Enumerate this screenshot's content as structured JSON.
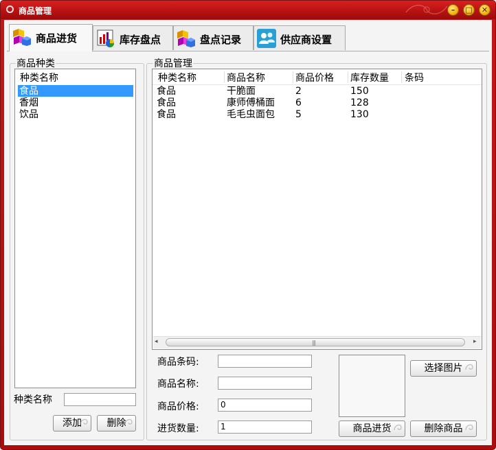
{
  "window": {
    "title": "商品管理"
  },
  "tabs": [
    {
      "label": "商品进货",
      "icon": "cubes-icon",
      "active": true
    },
    {
      "label": "库存盘点",
      "icon": "chart-icon",
      "active": false
    },
    {
      "label": "盘点记录",
      "icon": "cubes-icon",
      "active": false
    },
    {
      "label": "供应商设置",
      "icon": "users-icon",
      "active": false
    }
  ],
  "category_panel": {
    "title": "商品种类",
    "column": "种类名称",
    "items": [
      "食品",
      "香烟",
      "饮品"
    ],
    "selected_index": 0,
    "name_label": "种类名称",
    "name_value": "",
    "add_label": "添加",
    "delete_label": "删除"
  },
  "product_panel": {
    "title": "商品管理",
    "columns": [
      "种类名称",
      "商品名称",
      "商品价格",
      "库存数量",
      "条码"
    ],
    "rows": [
      [
        "食品",
        "干脆面",
        "2",
        "150",
        ""
      ],
      [
        "食品",
        "康师傅桶面",
        "6",
        "128",
        ""
      ],
      [
        "食品",
        "毛毛虫面包",
        "5",
        "130",
        ""
      ]
    ]
  },
  "form": {
    "barcode_label": "商品条码:",
    "barcode_value": "",
    "name_label": "商品名称:",
    "name_value": "",
    "price_label": "商品价格:",
    "price_value": "0",
    "qty_label": "进货数量:",
    "qty_value": "1",
    "choose_image_label": "选择图片",
    "purchase_label": "商品进货",
    "delete_product_label": "删除商品"
  },
  "colors": {
    "titlebar": "#c41818",
    "selection": "#3399ff",
    "frame": "#b01010"
  }
}
